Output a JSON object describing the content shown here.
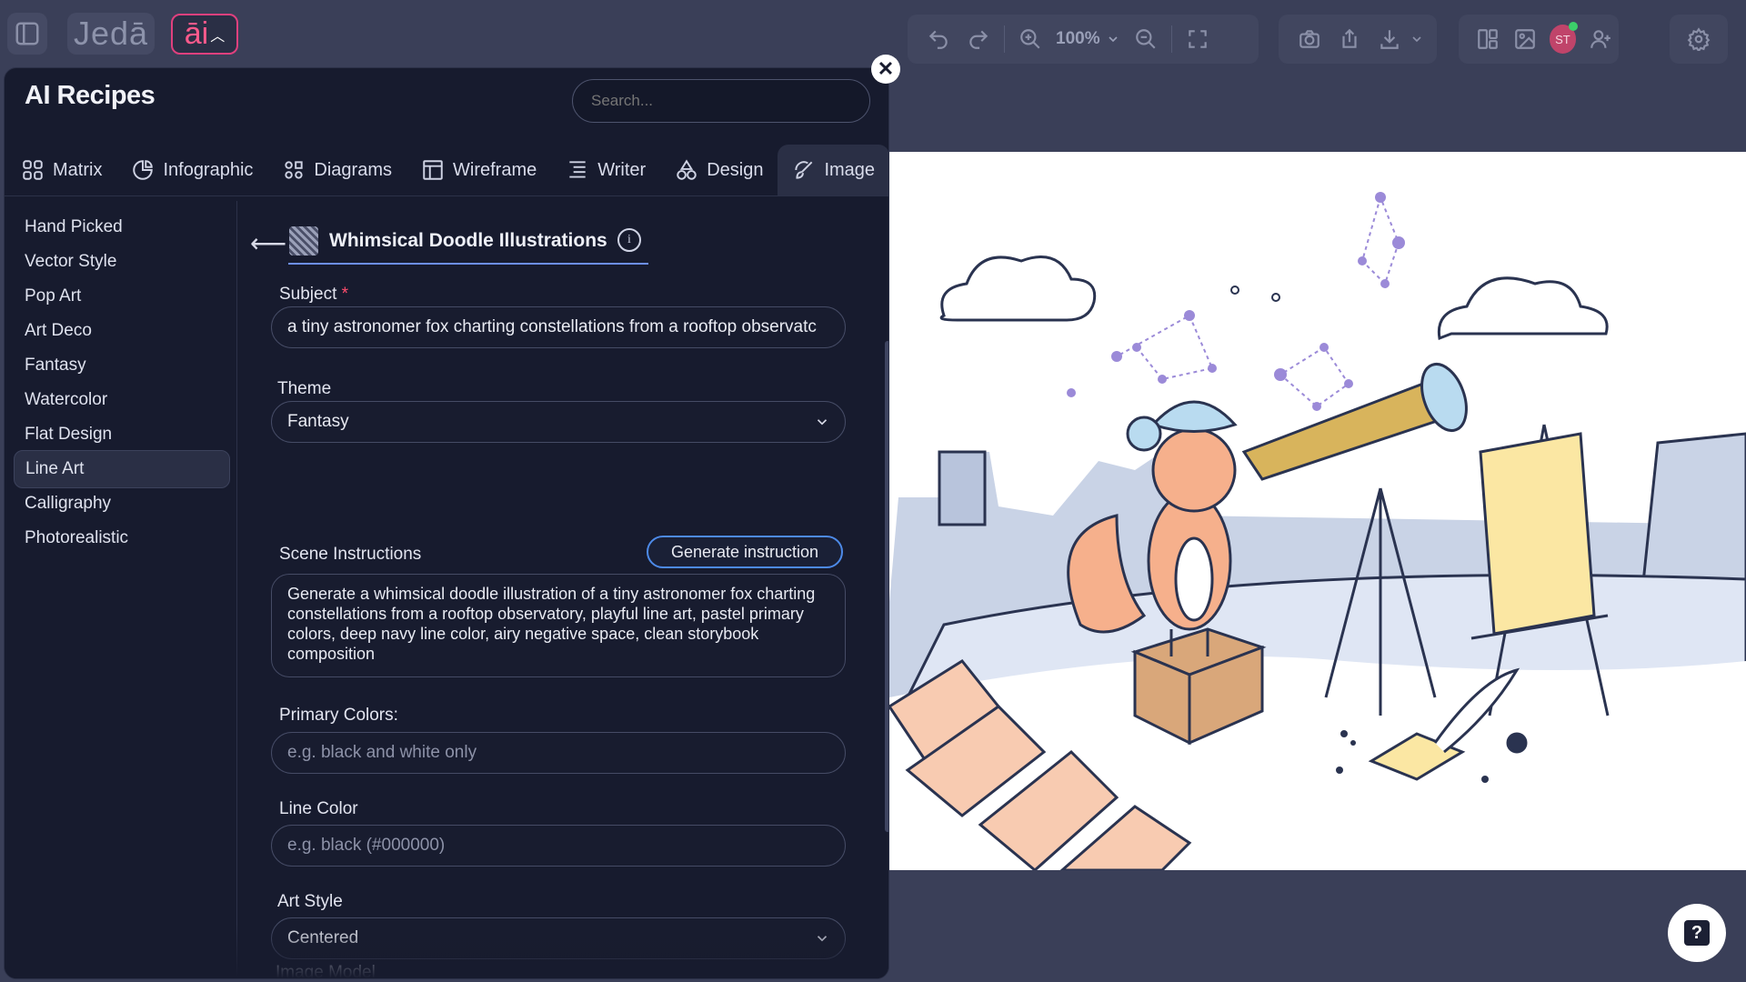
{
  "topbar": {
    "logo_text": "Jedā",
    "ai_label": "āi",
    "zoom_label": "100%",
    "avatar_initials": "ST"
  },
  "panel": {
    "title": "AI Recipes",
    "search_placeholder": "Search...",
    "tabs": [
      {
        "label": "Matrix",
        "icon": "grid-icon"
      },
      {
        "label": "Infographic",
        "icon": "pie-chart-icon"
      },
      {
        "label": "Diagrams",
        "icon": "diagram-icon"
      },
      {
        "label": "Wireframe",
        "icon": "wireframe-icon"
      },
      {
        "label": "Writer",
        "icon": "list-icon"
      },
      {
        "label": "Design",
        "icon": "shapes-icon"
      },
      {
        "label": "Image",
        "icon": "brush-icon",
        "active": true
      }
    ],
    "categories": [
      {
        "label": "Hand Picked"
      },
      {
        "label": "Vector Style"
      },
      {
        "label": "Pop Art"
      },
      {
        "label": "Art Deco"
      },
      {
        "label": "Fantasy"
      },
      {
        "label": "Watercolor"
      },
      {
        "label": "Flat Design"
      },
      {
        "label": "Line Art",
        "active": true
      },
      {
        "label": "Calligraphy"
      },
      {
        "label": "Photorealistic"
      }
    ]
  },
  "recipe": {
    "title": "Whimsical Doodle Illustrations",
    "subject_label": "Subject",
    "subject_required": "*",
    "subject_value": "a tiny astronomer fox charting constellations from a rooftop observatc",
    "theme_label": "Theme",
    "theme_value": "Fantasy",
    "scene_label": "Scene Instructions",
    "generate_label": "Generate instruction",
    "scene_value": "Generate a whimsical doodle illustration of a tiny astronomer fox charting constellations from a rooftop observatory, playful line art, pastel primary colors, deep navy line color, airy negative space, clean storybook composition",
    "primary_colors_label": "Primary Colors:",
    "primary_colors_placeholder": "e.g. black and white only",
    "line_color_label": "Line Color",
    "line_color_placeholder": "e.g. black (#000000)",
    "art_style_label": "Art Style",
    "art_style_value": "Centered",
    "image_model_label": "Image Model"
  },
  "colors": {
    "background": "#3a3f58",
    "panel": "#171b2e",
    "accent_pink": "#e0407e",
    "accent_blue": "#4d8ae8",
    "tab_underline": "#6d8ff0",
    "badge": "#7c4de0"
  }
}
